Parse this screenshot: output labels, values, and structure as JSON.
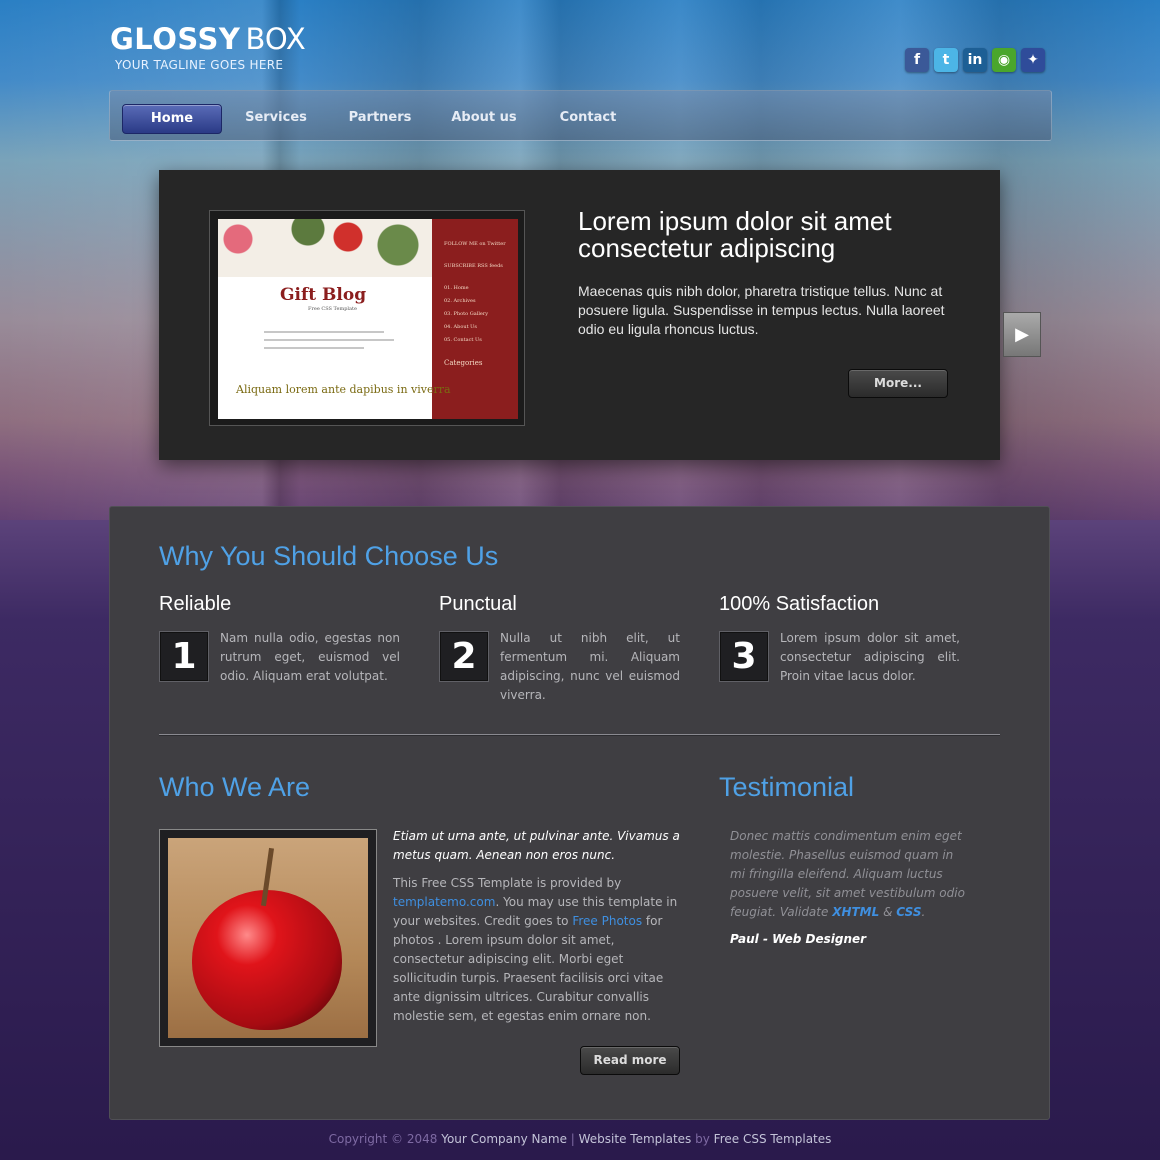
{
  "header": {
    "logo_bold": "GLOSSY",
    "logo_light": "BOX",
    "tagline": "YOUR TAGLINE GOES HERE",
    "social": [
      {
        "icon": "facebook-icon",
        "glyph": "f",
        "color": "#3b5998"
      },
      {
        "icon": "twitter-icon",
        "glyph": "t",
        "color": "#4cb5e6"
      },
      {
        "icon": "linkedin-icon",
        "glyph": "in",
        "color": "#1d5f95"
      },
      {
        "icon": "chat-icon",
        "glyph": "◉",
        "color": "#4aa62c"
      },
      {
        "icon": "myspace-icon",
        "glyph": "✦",
        "color": "#2f4c9a"
      }
    ]
  },
  "nav": {
    "items": [
      "Home",
      "Services",
      "Partners",
      "About us",
      "Contact"
    ],
    "active": "Home"
  },
  "slider": {
    "title": "Lorem ipsum dolor sit amet consectetur adipiscing",
    "text": "Maecenas quis nibh dolor, pharetra tristique tellus. Nunc at posuere ligula. Suspendisse in tempus lectus. Nulla laoreet odio eu ligula rhoncus luctus.",
    "more_label": "More...",
    "image": {
      "title": "Gift Blog",
      "subtitle": "Free CSS Template",
      "footer": "Aliquam lorem ante dapibus in viverra",
      "sidebar": [
        "FOLLOW ME on Twitter",
        "SUBSCRIBE RSS feeds",
        "01. Home",
        "02. Archives",
        "03. Photo Gallery",
        "04. About Us",
        "05. Contact Us",
        "Categories"
      ]
    }
  },
  "why": {
    "title": "Why You Should Choose Us",
    "features": [
      {
        "num": "1",
        "title": "Reliable",
        "text": "Nam nulla odio, egestas non rutrum eget, euismod vel odio. Aliquam erat volutpat."
      },
      {
        "num": "2",
        "title": "Punctual",
        "text": "Nulla ut nibh elit, ut fermentum mi. Aliquam adipiscing, nunc vel euismod viverra."
      },
      {
        "num": "3",
        "title": "100% Satisfaction",
        "text": "Lorem ipsum dolor sit amet, consectetur adipiscing elit. Proin vitae lacus dolor."
      }
    ]
  },
  "who": {
    "title": "Who We Are",
    "italic": "Etiam ut urna ante, ut pulvinar ante. Vivamus a metus quam. Aenean non eros nunc.",
    "p1": "This Free CSS Template is provided by ",
    "link1": "templatemo.com",
    "p2": ". You may use this template in your websites. Credit goes to ",
    "link2": "Free Photos",
    "p3": " for photos . Lorem ipsum dolor sit amet, consectetur adipiscing elit. Morbi eget sollicitudin turpis. Praesent facilisis orci vitae ante dignissim ultrices. Curabitur convallis molestie sem, et egestas enim ornare non.",
    "button": "Read more"
  },
  "testimonial": {
    "title": "Testimonial",
    "text": "Donec mattis condimentum enim eget molestie. Phasellus euismod quam in mi fringilla eleifend. Aliquam luctus posuere velit, sit amet vestibulum odio feugiat. Validate ",
    "xhtml": "XHTML",
    "amp": " & ",
    "css": "CSS",
    "dot": ".",
    "author": "Paul",
    "role": " - Web Designer"
  },
  "footer": {
    "copyright": "Copyright © 2048 ",
    "company": "Your Company Name",
    "sep": " | ",
    "templates": "Website Templates",
    "by": " by ",
    "free": "Free CSS Templates"
  }
}
